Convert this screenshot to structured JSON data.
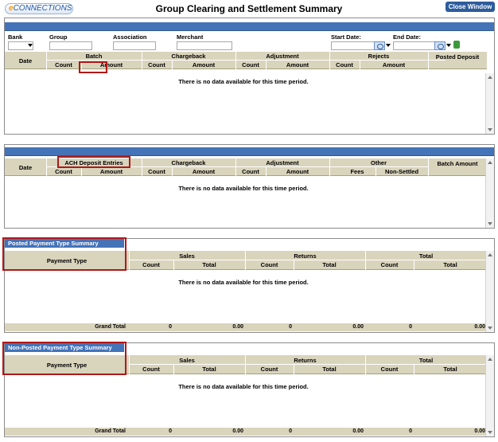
{
  "header": {
    "logo_e": "e",
    "logo_rest": "CONNECTIONS",
    "title": "Group Clearing and Settlement Summary",
    "close_label": "Close Window"
  },
  "filters": {
    "bank": "Bank",
    "group": "Group",
    "association": "Association",
    "merchant": "Merchant",
    "start_date": "Start Date:",
    "end_date": "End Date:"
  },
  "batch_table": {
    "date": "Date",
    "batch": "Batch",
    "chargeback": "Chargeback",
    "adjustment": "Adjustment",
    "rejects": "Rejects",
    "posted_deposit": "Posted Deposit",
    "count": "Count",
    "amount": "Amount",
    "no_data": "There is no data available for this time period."
  },
  "deposit_table": {
    "date": "Date",
    "ach": "ACH Deposit Entries",
    "chargeback": "Chargeback",
    "adjustment": "Adjustment",
    "other": "Other",
    "batch_amount": "Batch Amount",
    "count": "Count",
    "amount": "Amount",
    "fees": "Fees",
    "non_settled": "Non-Settled",
    "no_data": "There is no data available for this time period."
  },
  "posted_summary": {
    "title": "Posted Payment Type Summary",
    "payment_type": "Payment Type",
    "sales": "Sales",
    "returns": "Returns",
    "total": "Total",
    "count": "Count",
    "total_col": "Total",
    "no_data": "There is no data available for this time period.",
    "grand_total": "Grand Total",
    "sales_count": "0",
    "sales_total": "0.00",
    "returns_count": "0",
    "returns_total": "0.00",
    "total_count": "0",
    "total_total": "0.00"
  },
  "nonposted_summary": {
    "title": "Non-Posted Payment Type Summary",
    "payment_type": "Payment Type",
    "sales": "Sales",
    "returns": "Returns",
    "total": "Total",
    "count": "Count",
    "total_col": "Total",
    "no_data": "There is no data available for this time period.",
    "grand_total": "Grand Total",
    "sales_count": "0",
    "sales_total": "0.00",
    "returns_count": "0",
    "returns_total": "0.00",
    "total_count": "0",
    "total_total": "0.00"
  }
}
